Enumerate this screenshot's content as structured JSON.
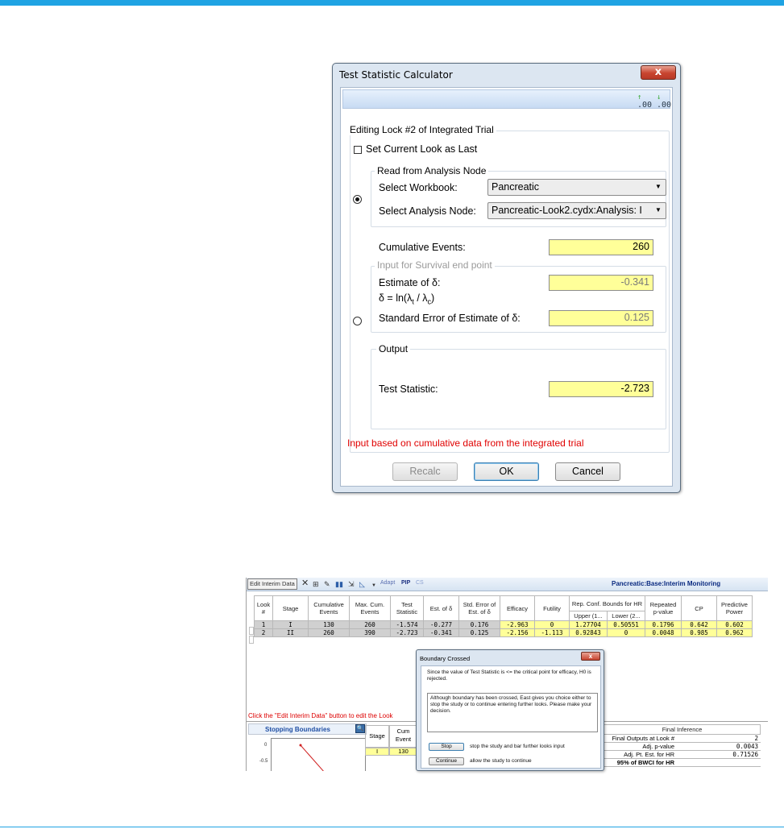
{
  "dialog": {
    "title": "Test Statistic Calculator",
    "close_glyph": "x",
    "toolbar_icons": [
      "increase-decimal-icon",
      "decrease-decimal-icon"
    ],
    "editing_group_label": "Editing Lock #2 of Integrated Trial",
    "set_current_look_label": "Set Current Look as Last",
    "read_group_label": "Read from Analysis Node",
    "select_workbook_label": "Select Workbook:",
    "select_workbook_value": "Pancreatic",
    "select_node_label": "Select Analysis Node:",
    "select_node_value": "Pancreatic-Look2.cydx:Analysis: I",
    "cumulative_events_label": "Cumulative Events:",
    "cumulative_events_value": "260",
    "survival_group_label": "Input for Survival end point",
    "estimate_label": "Estimate of δ:",
    "delta_formula_prefix": "δ = ln(λ",
    "delta_sub_t": "t",
    "delta_formula_mid": " / λ",
    "delta_sub_c": "c",
    "delta_formula_suffix": ")",
    "estimate_value": "-0.341",
    "se_label": "Standard Error of Estimate of δ:",
    "se_value": "0.125",
    "output_group_label": "Output",
    "test_stat_label": "Test Statistic:",
    "test_stat_value": "-2.723",
    "note": "Input based on cumulative data from the integrated trial",
    "recalc_label": "Recalc",
    "ok_label": "OK",
    "cancel_label": "Cancel"
  },
  "screenshot": {
    "edit_button_label": "Edit Interim Data",
    "toolbar_links": [
      "Adapt",
      "PIP",
      "CS"
    ],
    "title": "Pancreatic:Base:Interim Monitoring",
    "headers": {
      "look": "Look #",
      "stage": "Stage",
      "cum_events": "Cumulative Events",
      "max_cum_events": "Max. Cum. Events",
      "test_stat": "Test Statistic",
      "est_delta": "Est. of δ",
      "std_err": "Std. Error of Est. of δ",
      "efficacy": "Efficacy",
      "futility": "Futility",
      "rep_conf": "Rep. Conf. Bounds for HR",
      "upper": "Upper (1...",
      "lower": "Lower (2...",
      "rep_pvalue": "Repeated p-value",
      "cp": "CP",
      "pred_power": "Predictive Power"
    },
    "rows": [
      {
        "look": "1",
        "stage": "I",
        "cum_events": "130",
        "max_cum": "260",
        "test_stat": "-1.574",
        "est": "-0.277",
        "se": "0.176",
        "efficacy": "-2.963",
        "futility": "0",
        "upper": "1.27704",
        "lower": "0.50551",
        "pval": "0.1796",
        "cp": "0.642",
        "pp": "0.602"
      },
      {
        "look": "2",
        "stage": "II",
        "cum_events": "260",
        "max_cum": "390",
        "test_stat": "-2.723",
        "est": "-0.341",
        "se": "0.125",
        "efficacy": "-2.156",
        "futility": "-1.113",
        "upper": "0.92843",
        "lower": "0",
        "pval": "0.0048",
        "cp": "0.985",
        "pp": "0.962"
      }
    ],
    "click_message": "Click the \"Edit Interim Data\" button to edit the Look",
    "stopping_boundaries_label": "Stopping Boundaries",
    "plot_ticks": [
      "0",
      "-0.5"
    ],
    "stage_header": "Stage",
    "cum_header": "Cum Event",
    "stage_row": {
      "stage": "I",
      "cum": "130"
    },
    "final_inference": {
      "header": "Final Inference",
      "rows": [
        {
          "label": "Final Outputs at Look #",
          "value": "2"
        },
        {
          "label": "Adj. p-value",
          "value": "0.0043"
        },
        {
          "label": "Adj. Pt. Est. for HR",
          "value": "0.71526"
        },
        {
          "label": "95% of BWCI for HR",
          "value": ""
        }
      ]
    }
  },
  "boundary_dialog": {
    "title": "Boundary Crossed",
    "message": "Since the value of Test Statistic is <= the critical point for efficacy, H0 is rejected.",
    "detail": "Although boundary has been crossed, East gives you choice either to stop the study or to continue entering further looks. Please make your decision.",
    "stop_label": "Stop",
    "stop_desc": "stop the study and bar further looks input",
    "continue_label": "Continue",
    "continue_desc": "allow the study to continue"
  }
}
